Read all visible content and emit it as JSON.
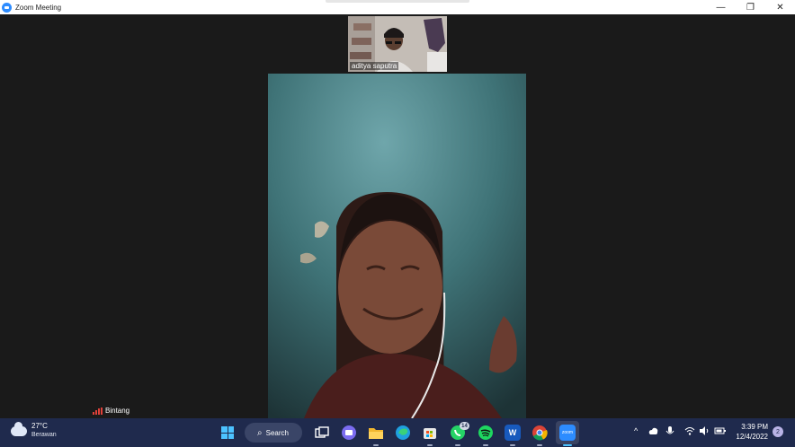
{
  "window": {
    "title": "Zoom Meeting",
    "controls": {
      "minimize": "—",
      "restore": "❐",
      "close": "✕"
    }
  },
  "participants": {
    "thumbnail": {
      "name": "aditya saputra"
    },
    "main": {
      "name": "Bintang"
    }
  },
  "taskbar": {
    "weather": {
      "temperature": "27°C",
      "condition": "Berawan",
      "icon": "cloud-icon"
    },
    "search_label": "Search",
    "apps": [
      {
        "name": "task-view",
        "icon": "task-view-icon"
      },
      {
        "name": "zoom-chat",
        "icon": "chat-icon"
      },
      {
        "name": "file-explorer",
        "icon": "folder-icon"
      },
      {
        "name": "edge",
        "icon": "edge-icon"
      },
      {
        "name": "store",
        "icon": "store-icon"
      },
      {
        "name": "whatsapp",
        "icon": "whatsapp-icon",
        "badge": "14"
      },
      {
        "name": "spotify",
        "icon": "spotify-icon"
      },
      {
        "name": "word",
        "icon": "word-icon",
        "label": "W"
      },
      {
        "name": "chrome",
        "icon": "chrome-icon"
      },
      {
        "name": "zoom",
        "icon": "zoom-icon",
        "label": "zoom"
      }
    ],
    "tray": {
      "chevron": "^",
      "time": "3:39 PM",
      "date": "12/4/2022",
      "notifications": "2"
    }
  },
  "colors": {
    "taskbar_bg": "#1f2a4d",
    "meeting_bg": "#1a1a1a",
    "zoom_blue": "#2d8cff",
    "signal_red": "#e0413a"
  }
}
